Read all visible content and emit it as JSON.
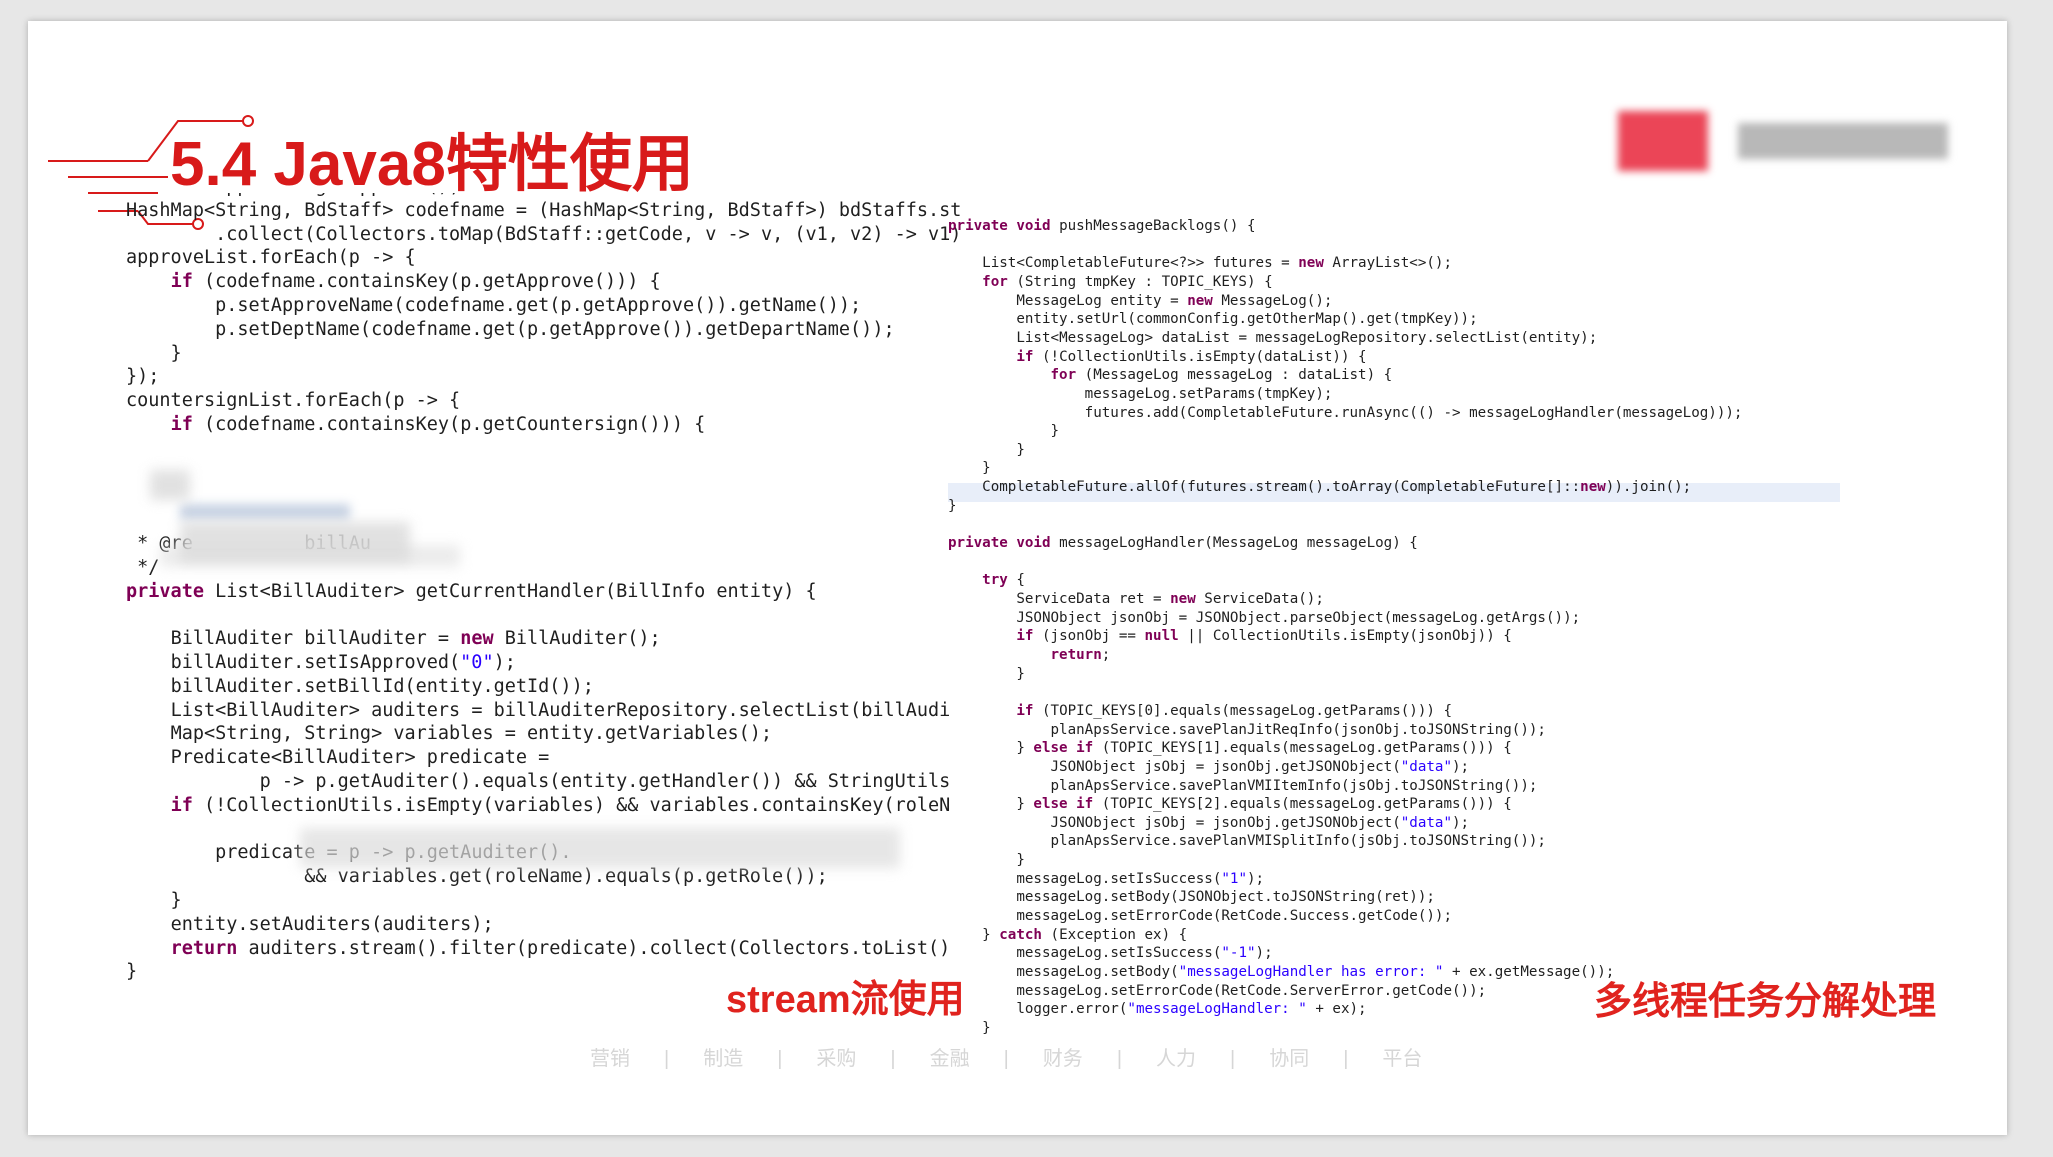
{
  "title": "5.4 Java8特性使用",
  "captions": {
    "left": "stream流使用",
    "right": "多线程任务分解处理"
  },
  "footer_items": [
    "营销",
    "制造",
    "采购",
    "金融",
    "财务",
    "人力",
    "协同",
    "平台"
  ],
  "colors": {
    "accent": "#d81a1a",
    "caption": "#e0231e",
    "keyword": "#7f0055",
    "field": "#0000c0"
  },
  "left_code": [
    "        approves.getApprove();",
    "HashMap<String, BdStaff> codefname = (HashMap<String, BdStaff>) bdStaffs.st",
    "        .collect(Collectors.toMap(BdStaff::getCode, v -> v, (v1, v2) -> v1)",
    "approveList.forEach(p -> {",
    "    if (codefname.containsKey(p.getApprove())) {",
    "        p.setApproveName(codefname.get(p.getApprove()).getName());",
    "        p.setDeptName(codefname.get(p.getApprove()).getDepartName());",
    "    }",
    "});",
    "countersignList.forEach(p -> {",
    "    if (codefname.containsKey(p.getCountersign())) {",
    "",
    "",
    "",
    "",
    " * @re          billAu",
    " */",
    "private List<BillAuditer> getCurrentHandler(BillInfo entity) {",
    "",
    "    BillAuditer billAuditer = new BillAuditer();",
    "    billAuditer.setIsApproved(\"0\");",
    "    billAuditer.setBillId(entity.getId());",
    "    List<BillAuditer> auditers = billAuditerRepository.selectList(billAudi",
    "    Map<String, String> variables = entity.getVariables();",
    "    Predicate<BillAuditer> predicate =",
    "            p -> p.getAuditer().equals(entity.getHandler()) && StringUtils",
    "    if (!CollectionUtils.isEmpty(variables) && variables.containsKey(roleN",
    "",
    "        predicate = p -> p.getAuditer().",
    "                && variables.get(roleName).equals(p.getRole());",
    "    }",
    "    entity.setAuditers(auditers);",
    "    return auditers.stream().filter(predicate).collect(Collectors.toList()",
    "}"
  ],
  "right_code": [
    "private void pushMessageBacklogs() {",
    "",
    "    List<CompletableFuture<?>> futures = new ArrayList<>();",
    "    for (String tmpKey : TOPIC_KEYS) {",
    "        MessageLog entity = new MessageLog();",
    "        entity.setUrl(commonConfig.getOtherMap().get(tmpKey));",
    "        List<MessageLog> dataList = messageLogRepository.selectList(entity);",
    "        if (!CollectionUtils.isEmpty(dataList)) {",
    "            for (MessageLog messageLog : dataList) {",
    "                messageLog.setParams(tmpKey);",
    "                futures.add(CompletableFuture.runAsync(() -> messageLogHandler(messageLog)));",
    "            }",
    "        }",
    "    }",
    "    CompletableFuture.allOf(futures.stream().toArray(CompletableFuture[]::new)).join();",
    "}",
    "",
    "private void messageLogHandler(MessageLog messageLog) {",
    "",
    "    try {",
    "        ServiceData ret = new ServiceData();",
    "        JSONObject jsonObj = JSONObject.parseObject(messageLog.getArgs());",
    "        if (jsonObj == null || CollectionUtils.isEmpty(jsonObj)) {",
    "            return;",
    "        }",
    "",
    "        if (TOPIC_KEYS[0].equals(messageLog.getParams())) {",
    "            planApsService.savePlanJitReqInfo(jsonObj.toJSONString());",
    "        } else if (TOPIC_KEYS[1].equals(messageLog.getParams())) {",
    "            JSONObject jsObj = jsonObj.getJSONObject(\"data\");",
    "            planApsService.savePlanVMIItemInfo(jsObj.toJSONString());",
    "        } else if (TOPIC_KEYS[2].equals(messageLog.getParams())) {",
    "            JSONObject jsObj = jsonObj.getJSONObject(\"data\");",
    "            planApsService.savePlanVMISplitInfo(jsObj.toJSONString());",
    "        }",
    "        messageLog.setIsSuccess(\"1\");",
    "        messageLog.setBody(JSONObject.toJSONString(ret));",
    "        messageLog.setErrorCode(RetCode.Success.getCode());",
    "    } catch (Exception ex) {",
    "        messageLog.setIsSuccess(\"-1\");",
    "        messageLog.setBody(\"messageLogHandler has error: \" + ex.getMessage());",
    "        messageLog.setErrorCode(RetCode.ServerError.getCode());",
    "        logger.error(\"messageLogHandler: \" + ex);",
    "    }"
  ]
}
